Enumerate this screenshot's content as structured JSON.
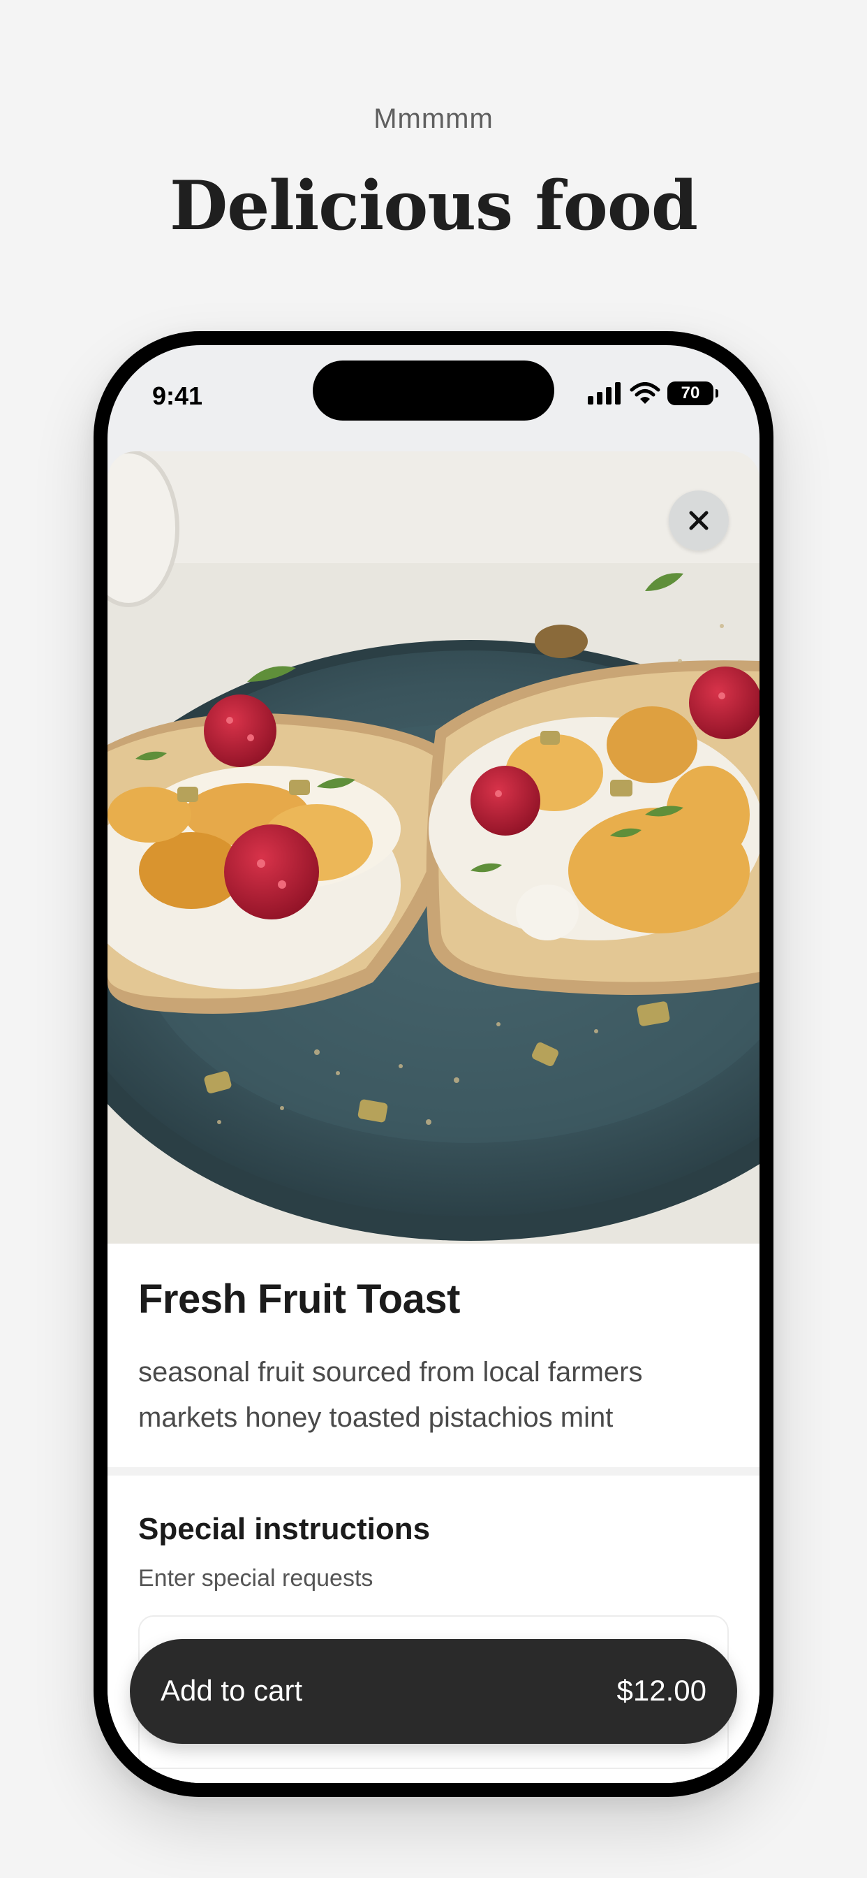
{
  "header": {
    "eyebrow": "Mmmmm",
    "title": "Delicious food"
  },
  "status_bar": {
    "time": "9:41",
    "battery": "70",
    "icons": [
      "cellular-signal-icon",
      "wifi-icon",
      "battery-icon"
    ]
  },
  "item": {
    "image_icon": "food-photo",
    "close_icon": "close-icon",
    "name": "Fresh Fruit Toast",
    "description": "seasonal fruit sourced from local farmers markets honey toasted pistachios mint"
  },
  "special_instructions": {
    "title": "Special instructions",
    "subtitle": "Enter special requests",
    "value": ""
  },
  "cart": {
    "label": "Add to cart",
    "price": "$12.00"
  },
  "colors": {
    "background": "#f4f4f4",
    "button": "#2a2a2a",
    "plate": "#3e5a63",
    "raspberry": "#b51f35"
  }
}
